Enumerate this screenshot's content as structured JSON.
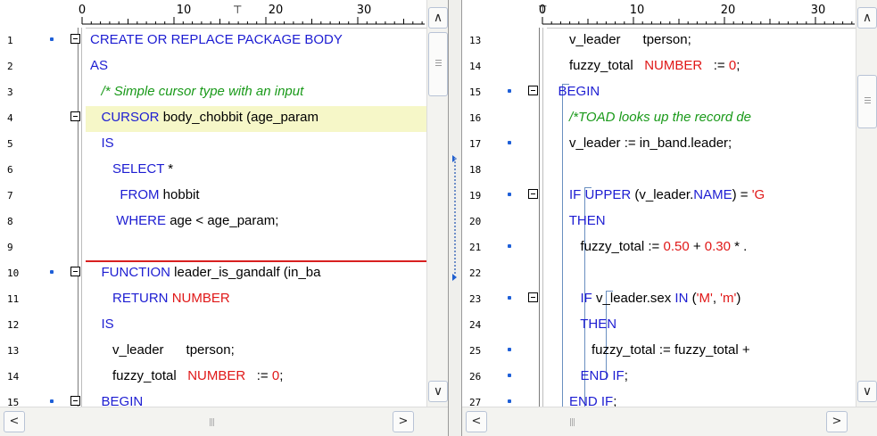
{
  "colors": {
    "keyword": "#1d1dd2",
    "number": "#e01818",
    "comment": "#1a9a1a",
    "breakpoint": "#1e5fd8",
    "highlight": "#f6f7c8",
    "separator": "#d82020"
  },
  "left_pane": {
    "ruler_numbers": [
      "0",
      "10",
      "20",
      "30"
    ],
    "lines": [
      {
        "n": "1",
        "dot": true,
        "fold": true,
        "code": "<span class=\"kw\">CREATE OR REPLACE PACKAGE BODY</span>"
      },
      {
        "n": "2",
        "dot": false,
        "fold": false,
        "code": "<span class=\"kw\">AS</span>"
      },
      {
        "n": "3",
        "dot": false,
        "fold": false,
        "code": "   <span class=\"cm\">/* Simple cursor type with an input</span>"
      },
      {
        "n": "4",
        "dot": false,
        "fold": true,
        "code": "   <span class=\"kw\">CURSOR</span> body_chobbit (age_param"
      },
      {
        "n": "5",
        "dot": false,
        "fold": false,
        "code": "   <span class=\"kw\">IS</span>"
      },
      {
        "n": "6",
        "dot": false,
        "fold": false,
        "code": "      <span class=\"kw\">SELECT</span> *"
      },
      {
        "n": "7",
        "dot": false,
        "fold": false,
        "code": "        <span class=\"kw\">FROM</span> hobbit"
      },
      {
        "n": "8",
        "dot": false,
        "fold": false,
        "code": "       <span class=\"kw\">WHERE</span> age &lt; age_param;"
      },
      {
        "n": "9",
        "dot": false,
        "fold": false,
        "code": ""
      },
      {
        "n": "10",
        "dot": true,
        "fold": true,
        "code": "   <span class=\"kw\">FUNCTION</span> leader_is_gandalf (in_ba"
      },
      {
        "n": "11",
        "dot": false,
        "fold": false,
        "code": "      <span class=\"kw\">RETURN</span> <span class=\"num\">NUMBER</span>"
      },
      {
        "n": "12",
        "dot": false,
        "fold": false,
        "code": "   <span class=\"kw\">IS</span>"
      },
      {
        "n": "13",
        "dot": false,
        "fold": false,
        "code": "      v_leader      tperson;"
      },
      {
        "n": "14",
        "dot": false,
        "fold": false,
        "code": "      fuzzy_total   <span class=\"num\">NUMBER</span>   := <span class=\"num\">0</span>;"
      },
      {
        "n": "15",
        "dot": true,
        "fold": true,
        "code": "   <span class=\"kw\">BEGIN</span>"
      }
    ]
  },
  "right_pane": {
    "ruler_numbers": [
      "0",
      "10",
      "20",
      "30"
    ],
    "lines": [
      {
        "n": "13",
        "dot": false,
        "fold": false,
        "code": "      v_leader      tperson;"
      },
      {
        "n": "14",
        "dot": false,
        "fold": false,
        "code": "      fuzzy_total   <span class=\"num\">NUMBER</span>   := <span class=\"num\">0</span>;"
      },
      {
        "n": "15",
        "dot": true,
        "fold": true,
        "code": "   <span class=\"kw\">BEGIN</span>"
      },
      {
        "n": "16",
        "dot": false,
        "fold": false,
        "code": "      <span class=\"cm\">/*TOAD looks up the record de</span>"
      },
      {
        "n": "17",
        "dot": true,
        "fold": false,
        "code": "      v_leader := in_band.leader;"
      },
      {
        "n": "18",
        "dot": false,
        "fold": false,
        "code": ""
      },
      {
        "n": "19",
        "dot": true,
        "fold": true,
        "code": "      <span class=\"kw\">IF UPPER</span> (v_leader.<span class=\"kw\">NAME</span>) = <span class=\"str\">'G</span>"
      },
      {
        "n": "20",
        "dot": false,
        "fold": false,
        "code": "      <span class=\"kw\">THEN</span>"
      },
      {
        "n": "21",
        "dot": true,
        "fold": false,
        "code": "         fuzzy_total := <span class=\"num\">0.50</span> + <span class=\"num\">0.30</span> * ."
      },
      {
        "n": "22",
        "dot": false,
        "fold": false,
        "code": ""
      },
      {
        "n": "23",
        "dot": true,
        "fold": true,
        "code": "         <span class=\"kw\">IF</span> v_leader.sex <span class=\"kw\">IN</span> (<span class=\"str\">'M'</span>, <span class=\"str\">'m'</span>)"
      },
      {
        "n": "24",
        "dot": false,
        "fold": false,
        "code": "         <span class=\"kw\">THEN</span>"
      },
      {
        "n": "25",
        "dot": true,
        "fold": false,
        "code": "            fuzzy_total := fuzzy_total +"
      },
      {
        "n": "26",
        "dot": true,
        "fold": false,
        "code": "         <span class=\"kw\">END IF</span>;"
      },
      {
        "n": "27",
        "dot": true,
        "fold": false,
        "code": "      <span class=\"kw\">END IF</span>;"
      }
    ]
  },
  "scroll": {
    "up_arrow": "∧",
    "down_arrow": "∨",
    "left_arrow": "<",
    "right_arrow": ">",
    "grip": "|||"
  }
}
